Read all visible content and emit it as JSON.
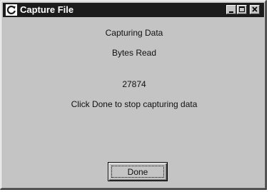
{
  "window": {
    "title": "Capture File",
    "controls": {
      "minimize_icon": "minimize-icon",
      "maximize_icon": "maximize-icon",
      "close_icon": "close-icon"
    },
    "app_icon": "capture-app-icon"
  },
  "content": {
    "status": "Capturing Data",
    "bytes_label": "Bytes Read",
    "bytes_value": "27874",
    "instruction": "Click Done to stop capturing data"
  },
  "buttons": {
    "done_label": "Done"
  },
  "colors": {
    "titlebar": "#1c1c1c",
    "face": "#c4c4c4",
    "text": "#111111"
  }
}
